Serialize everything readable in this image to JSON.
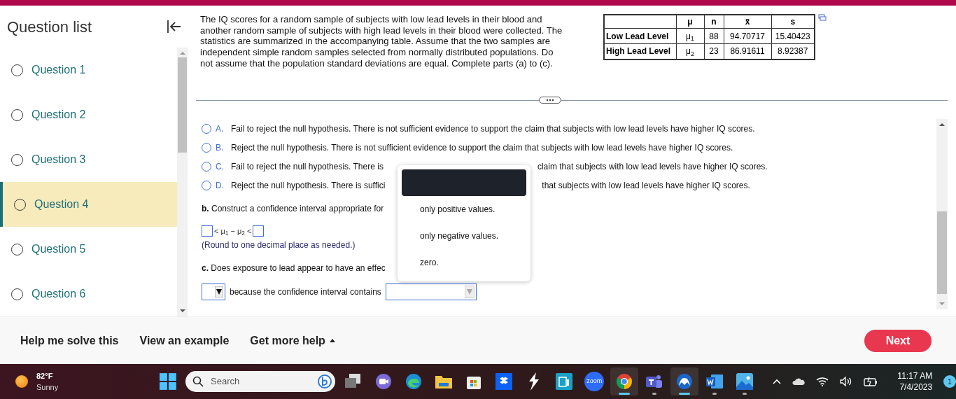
{
  "sidebar": {
    "title": "Question list",
    "items": [
      {
        "label": "Question 1",
        "selected": false
      },
      {
        "label": "Question 2",
        "selected": false
      },
      {
        "label": "Question 3",
        "selected": false
      },
      {
        "label": "Question 4",
        "selected": true
      },
      {
        "label": "Question 5",
        "selected": false
      },
      {
        "label": "Question 6",
        "selected": false
      }
    ]
  },
  "question": {
    "text": "The IQ scores for a random sample of subjects with low lead levels in their blood and another random sample of subjects with high lead levels in their blood were collected. The statistics are summarized in the accompanying table. Assume that the two samples are independent simple random samples selected from normally distributed populations. Do not assume that the population standard deviations are equal. Complete parts (a) to (c).",
    "table": {
      "columns": [
        "μ",
        "n",
        "x̄",
        "s"
      ],
      "rows": [
        {
          "label": "Low Lead Level",
          "cells": [
            "μ$_{1}$",
            "88",
            "94.70717",
            "15.40423"
          ]
        },
        {
          "label": "High Lead Level",
          "cells": [
            "μ$_{2}$",
            "23",
            "86.91611",
            "8.92387"
          ]
        }
      ]
    }
  },
  "options": [
    {
      "letter": "A.",
      "selected": false,
      "text_before": "Fail to reject the null hypothesis. There is not sufficient evidence to support the claim that subjects with low lead levels have higher IQ scores."
    },
    {
      "letter": "B.",
      "selected": false,
      "text_before": "Reject the null hypothesis. There is not sufficient evidence to support the claim that subjects with low lead levels have higher IQ scores."
    },
    {
      "letter": "C.",
      "selected": false,
      "text_before": "Fail to reject the null hypothesis. There is",
      "text_after": "claim that subjects with low lead levels have higher IQ scores."
    },
    {
      "letter": "D.",
      "selected": false,
      "text_before": "Reject the null hypothesis. There is suffici",
      "text_after": "that subjects with low lead levels have higher IQ scores."
    }
  ],
  "part_b": {
    "label": "b.",
    "text": "Construct a confidence interval appropriate for",
    "interval": "< μ$_{1}$ − μ$_{2}$ <",
    "note": "(Round to one decimal place as needed.)"
  },
  "part_c": {
    "label": "c.",
    "text": "Does exposure to lead appear to have an effec",
    "answer_text": "because the confidence interval contains"
  },
  "dropdown": {
    "blank_option_highlighted": true,
    "options": [
      {
        "label": "only positive values."
      },
      {
        "label": "only negative values."
      },
      {
        "label": "zero."
      }
    ]
  },
  "footer": {
    "links": [
      {
        "label": "Help me solve this",
        "kind": "plain"
      },
      {
        "label": "View an example",
        "kind": "plain"
      },
      {
        "label": "Get more help",
        "kind": "menu"
      }
    ],
    "next": "Next"
  },
  "taskbar": {
    "weather": {
      "temp": "82°F",
      "condition": "Sunny"
    },
    "search": {
      "placeholder": "Search"
    },
    "apps": [
      {
        "kind": "taskview",
        "running": false,
        "active": false
      },
      {
        "kind": "meet",
        "running": false,
        "active": false
      },
      {
        "kind": "edge",
        "running": false,
        "active": false
      },
      {
        "kind": "folder",
        "running": false,
        "active": false
      },
      {
        "kind": "store",
        "running": false,
        "active": false
      },
      {
        "kind": "dropbox",
        "running": false,
        "active": false
      },
      {
        "kind": "bolt",
        "running": false,
        "active": false
      },
      {
        "kind": "printer",
        "running": false,
        "active": false
      },
      {
        "kind": "zoom",
        "running": false,
        "active": false,
        "label": "zoom"
      },
      {
        "kind": "chrome",
        "running": true,
        "active": true
      },
      {
        "kind": "teams",
        "running": true,
        "active": false
      },
      {
        "kind": "vpn",
        "running": true,
        "active": true
      },
      {
        "kind": "word",
        "running": true,
        "active": false
      },
      {
        "kind": "photos",
        "running": true,
        "active": false
      }
    ],
    "time": "11:17 AM",
    "date": "7/4/2023",
    "notifications": "1"
  }
}
